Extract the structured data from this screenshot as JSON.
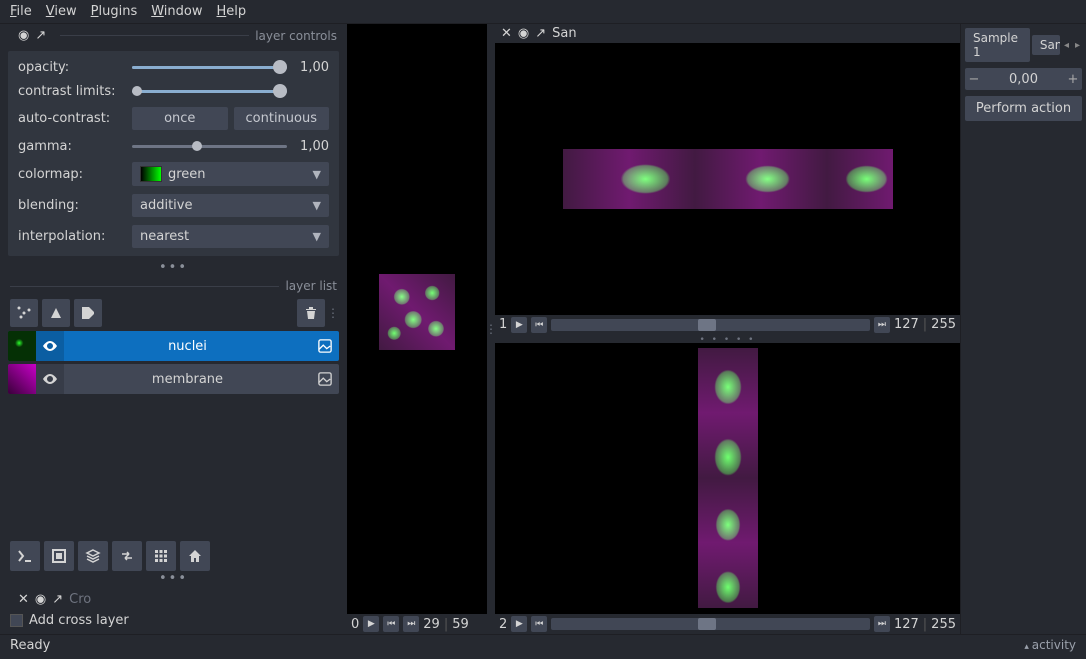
{
  "menu": {
    "file": "File",
    "view": "View",
    "plugins": "Plugins",
    "window": "Window",
    "help": "Help"
  },
  "panels": {
    "layer_controls": "layer controls",
    "layer_list": "layer list"
  },
  "controls": {
    "opacity_label": "opacity:",
    "opacity_value": "1,00",
    "contrast_label": "contrast limits:",
    "autocontrast_label": "auto-contrast:",
    "once": "once",
    "continuous": "continuous",
    "gamma_label": "gamma:",
    "gamma_value": "1,00",
    "colormap_label": "colormap:",
    "colormap_value": "green",
    "blending_label": "blending:",
    "blending_value": "additive",
    "interp_label": "interpolation:",
    "interp_value": "nearest"
  },
  "layers": [
    {
      "name": "nuclei",
      "selected": true
    },
    {
      "name": "membrane",
      "selected": false
    }
  ],
  "cross": {
    "tab": "Cro",
    "checkbox_label": "Add cross layer"
  },
  "viewers": {
    "top_tab": "San",
    "axis0": {
      "label": "0",
      "cur": "29",
      "max": "59"
    },
    "axis1": {
      "label": "1",
      "cur": "127",
      "max": "255"
    },
    "axis2": {
      "label": "2",
      "cur": "127",
      "max": "255"
    }
  },
  "right": {
    "tab1": "Sample 1",
    "tab2": "San",
    "spin_value": "0,00",
    "action": "Perform action"
  },
  "status": {
    "ready": "Ready",
    "activity": "activity"
  }
}
